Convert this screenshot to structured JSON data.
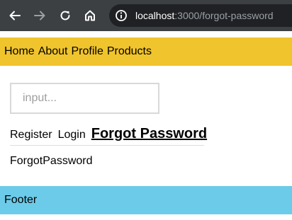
{
  "browser": {
    "url_host": "localhost",
    "url_rest": ":3000/forgot-password",
    "icons": [
      "back-icon",
      "forward-icon",
      "reload-icon",
      "home-icon",
      "site-info-icon"
    ],
    "colors": {
      "chrome_bg": "#3c4043",
      "omnibox_bg": "#202124"
    }
  },
  "nav": {
    "items": [
      {
        "label": "Home"
      },
      {
        "label": "About"
      },
      {
        "label": "Profile"
      },
      {
        "label": "Products"
      }
    ],
    "color": "#f0c42c"
  },
  "search": {
    "placeholder": "input..."
  },
  "auth_tabs": {
    "register_label": "Register",
    "login_label": "Login",
    "forgot_password_label": "Forgot Password",
    "active": "Forgot Password"
  },
  "content": {
    "text": "ForgotPassword"
  },
  "footer": {
    "text": "Footer",
    "color": "#6ccbe8"
  }
}
